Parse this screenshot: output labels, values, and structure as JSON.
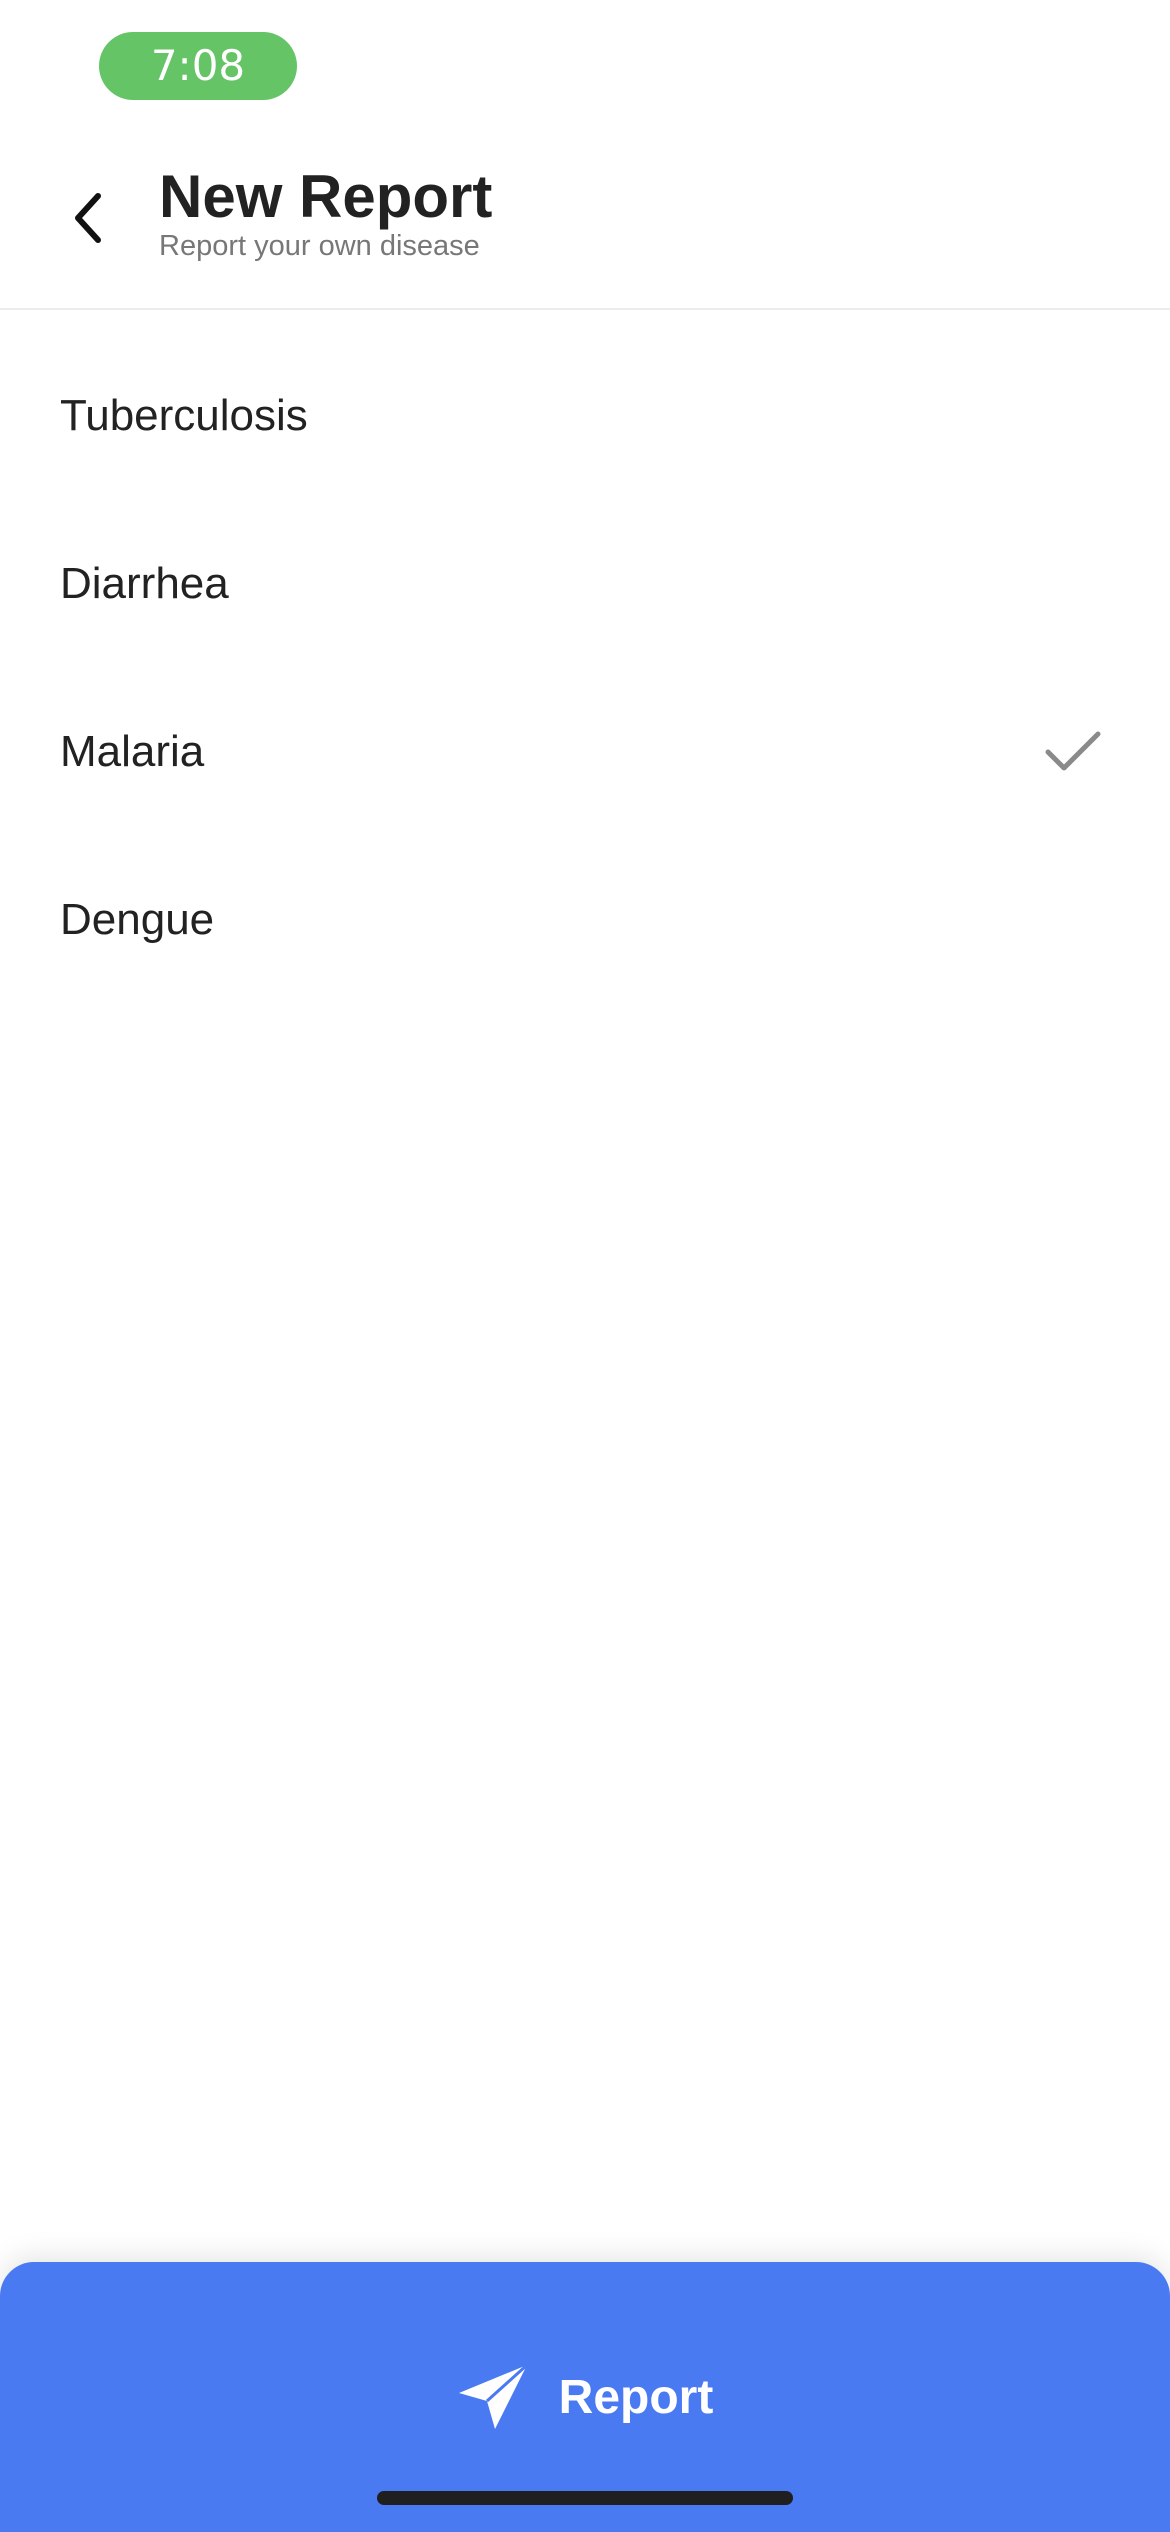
{
  "status_bar": {
    "time": "7:08",
    "time_pill_color": "#65c466"
  },
  "header": {
    "back_icon": "chevron-left-icon",
    "title": "New Report",
    "subtitle": "Report your own disease"
  },
  "diseases": [
    {
      "label": "Tuberculosis",
      "selected": false
    },
    {
      "label": "Diarrhea",
      "selected": false
    },
    {
      "label": "Malaria",
      "selected": true
    },
    {
      "label": "Dengue",
      "selected": false
    }
  ],
  "report_button": {
    "label": "Report",
    "icon": "send-icon",
    "color": "#4a7af2"
  }
}
